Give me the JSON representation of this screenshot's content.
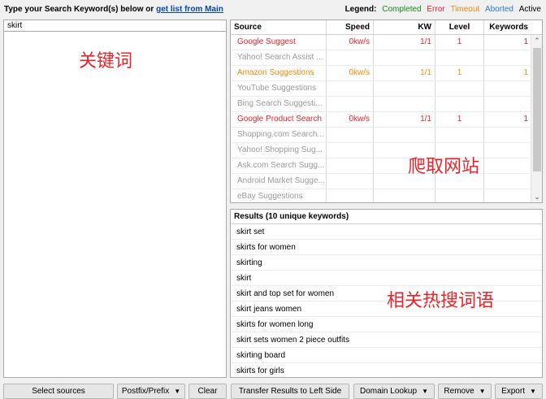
{
  "header": {
    "prompt": "Type your Search Keyword(s) below or ",
    "link": "get list from Main"
  },
  "legend": {
    "title": "Legend:",
    "completed": "Completed",
    "error": "Error",
    "timeout": "Timeout",
    "aborted": "Aborted",
    "active": "Active",
    "colors": {
      "completed": "#1a8a1a",
      "error": "#e8242a",
      "timeout": "#f28b0c",
      "aborted": "#2b7bd6",
      "active": "#000000"
    }
  },
  "keyword_input": {
    "value": "skirt"
  },
  "annotations": {
    "keywords": "关键词",
    "crawl_sites": "爬取网站",
    "related": "相关热搜词语"
  },
  "sources": {
    "headers": {
      "source": "Source",
      "speed": "Speed",
      "kw": "KW",
      "level": "Level",
      "keywords": "Keywords"
    },
    "rows": [
      {
        "source": "Google Suggest",
        "speed": "0kw/s",
        "kw": "1/1",
        "level": "1",
        "keywords": "1",
        "status": "red"
      },
      {
        "source": "Yahoo! Search Assist ...",
        "speed": "",
        "kw": "",
        "level": "",
        "keywords": "",
        "status": "grey"
      },
      {
        "source": "Amazon Suggestions",
        "speed": "0kw/s",
        "kw": "1/1",
        "level": "1",
        "keywords": "1",
        "status": "orange"
      },
      {
        "source": "YouTube Suggestions",
        "speed": "",
        "kw": "",
        "level": "",
        "keywords": "",
        "status": "grey"
      },
      {
        "source": "Bing Search Suggesti...",
        "speed": "",
        "kw": "",
        "level": "",
        "keywords": "",
        "status": "grey"
      },
      {
        "source": "Google Product Search",
        "speed": "0kw/s",
        "kw": "1/1",
        "level": "1",
        "keywords": "1",
        "status": "red"
      },
      {
        "source": "Shopping.com Search...",
        "speed": "",
        "kw": "",
        "level": "",
        "keywords": "",
        "status": "grey"
      },
      {
        "source": "Yahoo! Shopping Sug...",
        "speed": "",
        "kw": "",
        "level": "",
        "keywords": "",
        "status": "grey"
      },
      {
        "source": "Ask.com Search Sugg...",
        "speed": "",
        "kw": "",
        "level": "",
        "keywords": "",
        "status": "grey"
      },
      {
        "source": "Android Market Sugge...",
        "speed": "",
        "kw": "",
        "level": "",
        "keywords": "",
        "status": "grey"
      },
      {
        "source": "eBay Suggestions",
        "speed": "",
        "kw": "",
        "level": "",
        "keywords": "",
        "status": "grey"
      }
    ]
  },
  "results": {
    "title": "Results (10 unique keywords)",
    "items": [
      "skirt set",
      "skirts for women",
      "skirting",
      "skirt",
      "skirt and top set for women",
      "skirt jeans women",
      "skirts for women long",
      "skirt sets women 2 piece outfits",
      "skirting board",
      "skirts for girls"
    ]
  },
  "buttons": {
    "select_sources": "Select sources",
    "postfix_prefix": "Postfix/Prefix",
    "clear": "Clear",
    "transfer": "Transfer Results to Left Side",
    "domain_lookup": "Domain Lookup",
    "remove": "Remove",
    "export": "Export"
  }
}
